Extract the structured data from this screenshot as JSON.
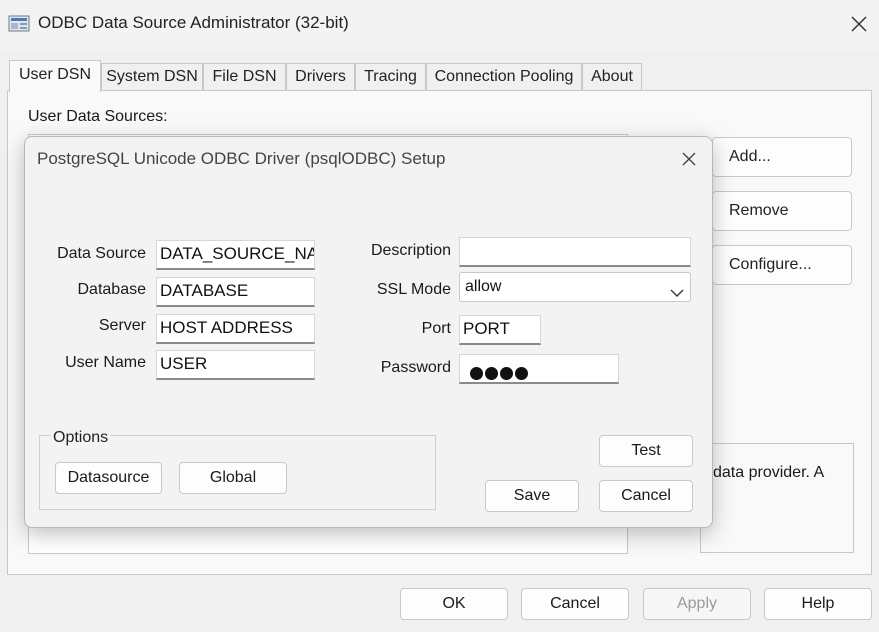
{
  "window": {
    "title": "ODBC Data Source Administrator (32-bit)"
  },
  "tabs": [
    {
      "label": "User DSN",
      "active": true
    },
    {
      "label": "System DSN"
    },
    {
      "label": "File DSN"
    },
    {
      "label": "Drivers"
    },
    {
      "label": "Tracing"
    },
    {
      "label": "Connection Pooling"
    },
    {
      "label": "About"
    }
  ],
  "user_dsn": {
    "list_label": "User Data Sources:",
    "buttons": {
      "add": "Add...",
      "remove": "Remove",
      "configure": "Configure..."
    },
    "info_text": "data provider.  A"
  },
  "footer": {
    "ok": "OK",
    "cancel": "Cancel",
    "apply": "Apply",
    "help": "Help"
  },
  "dialog": {
    "title": "PostgreSQL Unicode ODBC Driver (psqlODBC) Setup",
    "fields": {
      "data_source": {
        "label": "Data Source",
        "value": "DATA_SOURCE_NA"
      },
      "database": {
        "label": "Database",
        "value": "DATABASE"
      },
      "server": {
        "label": "Server",
        "value": "HOST ADDRESS"
      },
      "user_name": {
        "label": "User Name",
        "value": "USER"
      },
      "description": {
        "label": "Description",
        "value": ""
      },
      "ssl_mode": {
        "label": "SSL Mode",
        "value": "allow"
      },
      "port": {
        "label": "Port",
        "value": "PORT"
      },
      "password": {
        "label": "Password",
        "masked_length": 4
      }
    },
    "options": {
      "legend": "Options",
      "datasource_button": "Datasource",
      "global_button": "Global"
    },
    "buttons": {
      "test": "Test",
      "save": "Save",
      "cancel": "Cancel"
    }
  },
  "icons": {
    "app": "odbc-admin-icon",
    "close": "close-icon",
    "dropdown": "chevron-down-icon"
  }
}
